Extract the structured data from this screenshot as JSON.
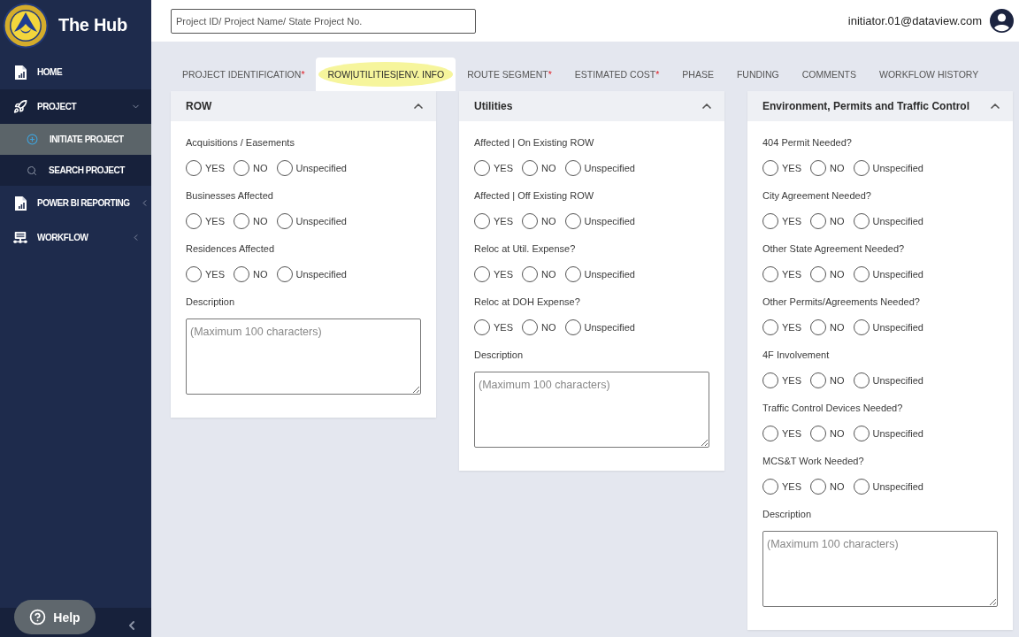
{
  "sidebar": {
    "brand": "The Hub",
    "items": [
      {
        "label": "HOME",
        "kind": "link",
        "selected": false
      },
      {
        "label": "PROJECT",
        "kind": "group",
        "selected": true,
        "expanded": true,
        "children": [
          {
            "label": "INITIATE PROJECT",
            "selected": true
          },
          {
            "label": "SEARCH PROJECT",
            "selected": false
          }
        ]
      },
      {
        "label": "POWER BI REPORTING",
        "kind": "group",
        "selected": false,
        "expanded": false
      },
      {
        "label": "WORKFLOW",
        "kind": "group",
        "selected": false,
        "expanded": false
      }
    ],
    "help": "Help"
  },
  "header": {
    "search": {
      "placeholder": "Project ID/ Project Name/ State Project No."
    },
    "user_email": "initiator.01@dataview.com"
  },
  "tabs": [
    {
      "label": "PROJECT IDENTIFICATION",
      "required_mark": "*",
      "selected": false
    },
    {
      "label": "ROW|UTILITIES|ENV. INFO",
      "selected": true
    },
    {
      "label": "ROUTE SEGMENT",
      "required_mark": "*",
      "selected": false
    },
    {
      "label": "ESTIMATED COST",
      "required_mark": "*",
      "selected": false
    },
    {
      "label": "PHASE",
      "selected": false
    },
    {
      "label": "FUNDING",
      "selected": false
    },
    {
      "label": "COMMENTS",
      "selected": false
    },
    {
      "label": "WORKFLOW HISTORY",
      "selected": false
    }
  ],
  "sections": [
    {
      "title": "ROW",
      "expanded": true,
      "questions": [
        {
          "label": "Acquisitions / Easements",
          "options": [
            {
              "label": "YES",
              "selected": false
            },
            {
              "label": "NO",
              "selected": false
            },
            {
              "label": "Unspecified",
              "selected": false
            }
          ]
        },
        {
          "label": "Businesses Affected",
          "options": [
            {
              "label": "YES",
              "selected": false
            },
            {
              "label": "NO",
              "selected": false
            },
            {
              "label": "Unspecified",
              "selected": false
            }
          ]
        },
        {
          "label": "Residences Affected",
          "options": [
            {
              "label": "YES",
              "selected": false
            },
            {
              "label": "NO",
              "selected": false
            },
            {
              "label": "Unspecified",
              "selected": false
            }
          ]
        }
      ],
      "description": {
        "label": "Description",
        "placeholder": "(Maximum 100 characters)"
      }
    },
    {
      "title": "Utilities",
      "expanded": true,
      "questions": [
        {
          "label": "Affected | On Existing ROW",
          "options": [
            {
              "label": "YES",
              "selected": false
            },
            {
              "label": "NO",
              "selected": false
            },
            {
              "label": "Unspecified",
              "selected": false
            }
          ]
        },
        {
          "label": "Affected | Off Existing ROW",
          "options": [
            {
              "label": "YES",
              "selected": false
            },
            {
              "label": "NO",
              "selected": false
            },
            {
              "label": "Unspecified",
              "selected": false
            }
          ]
        },
        {
          "label": "Reloc at Util. Expense?",
          "options": [
            {
              "label": "YES",
              "selected": false
            },
            {
              "label": "NO",
              "selected": false
            },
            {
              "label": "Unspecified",
              "selected": false
            }
          ]
        },
        {
          "label": "Reloc at DOH Expense?",
          "options": [
            {
              "label": "YES",
              "selected": false
            },
            {
              "label": "NO",
              "selected": false
            },
            {
              "label": "Unspecified",
              "selected": false
            }
          ]
        }
      ],
      "description": {
        "label": "Description",
        "placeholder": "(Maximum 100 characters)"
      }
    },
    {
      "title": "Environment, Permits and Traffic Control",
      "expanded": true,
      "questions": [
        {
          "label": "404 Permit Needed?",
          "options": [
            {
              "label": "YES",
              "selected": false
            },
            {
              "label": "NO",
              "selected": false
            },
            {
              "label": "Unspecified",
              "selected": false
            }
          ]
        },
        {
          "label": "City Agreement Needed?",
          "options": [
            {
              "label": "YES",
              "selected": false
            },
            {
              "label": "NO",
              "selected": false
            },
            {
              "label": "Unspecified",
              "selected": false
            }
          ]
        },
        {
          "label": "Other State Agreement Needed?",
          "options": [
            {
              "label": "YES",
              "selected": false
            },
            {
              "label": "NO",
              "selected": false
            },
            {
              "label": "Unspecified",
              "selected": false
            }
          ]
        },
        {
          "label": "Other Permits/Agreements Needed?",
          "options": [
            {
              "label": "YES",
              "selected": false
            },
            {
              "label": "NO",
              "selected": false
            },
            {
              "label": "Unspecified",
              "selected": false
            }
          ]
        },
        {
          "label": "4F Involvement",
          "options": [
            {
              "label": "YES",
              "selected": false
            },
            {
              "label": "NO",
              "selected": false
            },
            {
              "label": "Unspecified",
              "selected": false
            }
          ]
        },
        {
          "label": "Traffic Control Devices Needed?",
          "options": [
            {
              "label": "YES",
              "selected": false
            },
            {
              "label": "NO",
              "selected": false
            },
            {
              "label": "Unspecified",
              "selected": false
            }
          ]
        },
        {
          "label": "MCS&T Work Needed?",
          "options": [
            {
              "label": "YES",
              "selected": false
            },
            {
              "label": "NO",
              "selected": false
            },
            {
              "label": "Unspecified",
              "selected": false
            }
          ]
        }
      ],
      "description": {
        "label": "Description",
        "placeholder": "(Maximum 100 characters)"
      }
    }
  ]
}
